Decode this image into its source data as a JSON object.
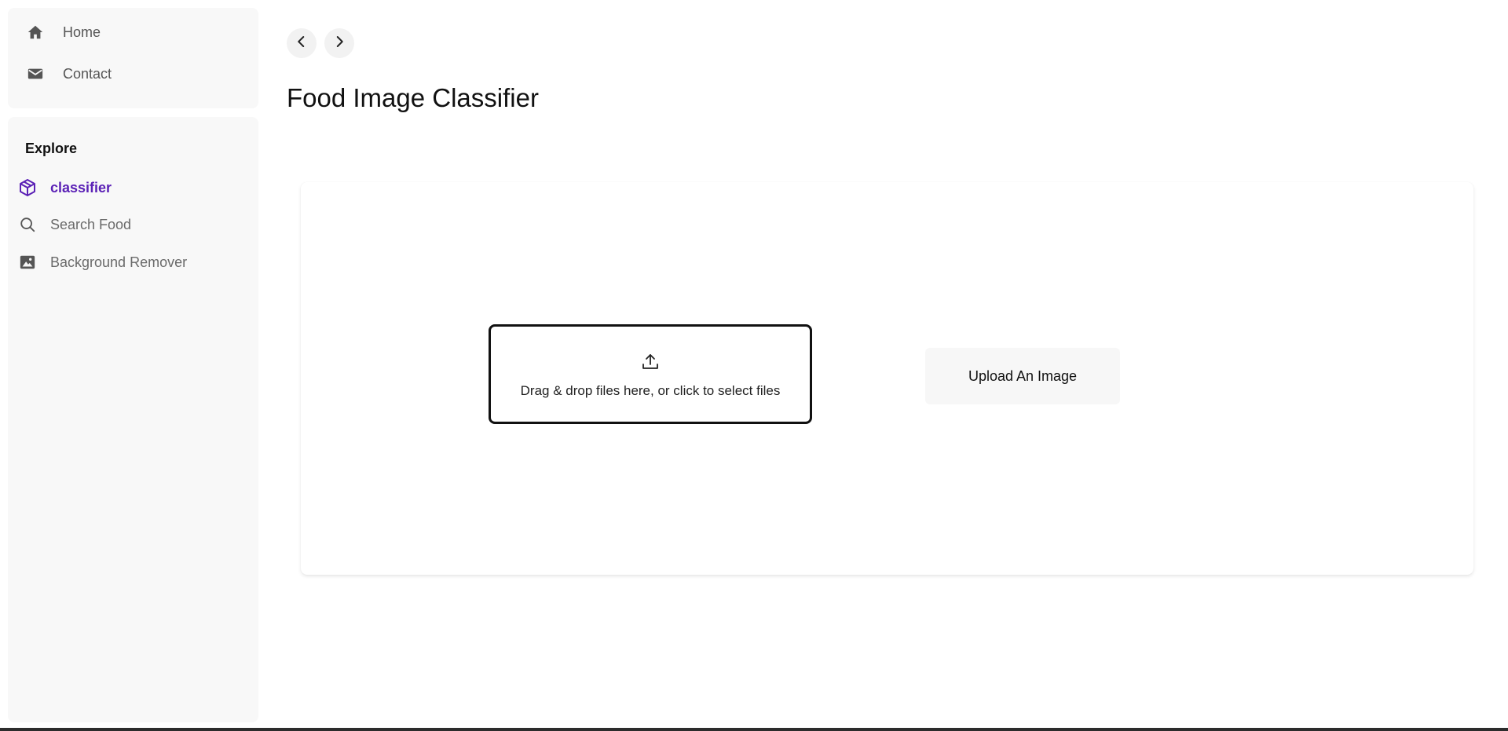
{
  "sidebar": {
    "top_items": [
      {
        "label": "Home",
        "icon": "home-icon"
      },
      {
        "label": "Contact",
        "icon": "mail-icon"
      }
    ],
    "section_title": "Explore",
    "explore_items": [
      {
        "label": "classifier",
        "icon": "box-icon",
        "active": true
      },
      {
        "label": "Search Food",
        "icon": "search-icon",
        "active": false
      },
      {
        "label": "Background Remover",
        "icon": "image-icon",
        "active": false
      }
    ]
  },
  "header": {
    "back_icon": "chevron-left-icon",
    "forward_icon": "chevron-right-icon",
    "title": "Food Image Classifier"
  },
  "main": {
    "dropzone": {
      "icon": "upload-icon",
      "text": "Drag & drop files here, or click to select files"
    },
    "upload_button_label": "Upload An Image"
  },
  "colors": {
    "accent": "#5b21b6",
    "sidebar_bg": "#f8f8f8",
    "text_muted": "#6a6a6a"
  }
}
